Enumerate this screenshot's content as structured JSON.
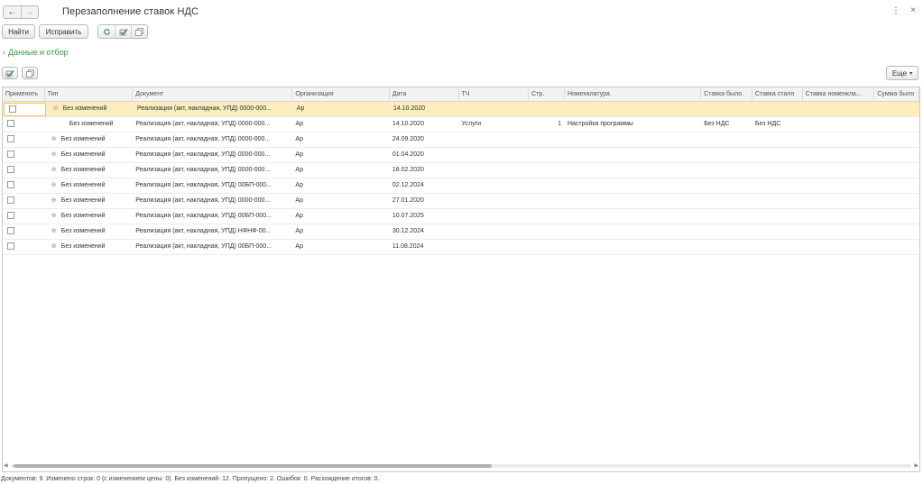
{
  "window": {
    "title": "Перезаполнение ставок НДС",
    "more_icon": "more-vertical-icon",
    "close_icon": "close-icon"
  },
  "toolbar": {
    "find_label": "Найти",
    "fix_label": "Исправить"
  },
  "filter": {
    "toggle_label": "Данные и отбор"
  },
  "grid_toolbar": {
    "more_label": "Еще"
  },
  "table": {
    "columns": {
      "apply": "Применять",
      "type": "Тип",
      "document": "Документ",
      "org": "Организация",
      "date": "Дата",
      "tch": "ТЧ",
      "str": "Стр.",
      "nom": "Номенклатура",
      "before": "Ставка было",
      "after": "Ставка стало",
      "nomrate": "Ставка номенкла...",
      "sum": "Сумма было"
    },
    "rows": [
      {
        "type": "Без изменений",
        "document": "Реализация (акт, накладная, УПД) 0000-000...",
        "org": "Ар",
        "date": "14.10.2020",
        "tch": "",
        "str": "",
        "nom": "",
        "before": "",
        "after": "",
        "nomrate": "",
        "sum": ""
      },
      {
        "type": "Без изменений",
        "document": "Реализация (акт, накладная, УПД) 0000-000...",
        "org": "Ар",
        "date": "14.10.2020",
        "tch": "Услуги",
        "str": "1",
        "nom": "Настройка программы",
        "before": "Без НДС",
        "after": "Без НДС",
        "nomrate": "",
        "sum": ""
      },
      {
        "type": "Без изменений",
        "document": "Реализация (акт, накладная, УПД) 0000-000...",
        "org": "Ар",
        "date": "24.09.2020",
        "tch": "",
        "str": "",
        "nom": "",
        "before": "",
        "after": "",
        "nomrate": "",
        "sum": ""
      },
      {
        "type": "Без изменений",
        "document": "Реализация (акт, накладная, УПД) 0000-000...",
        "org": "Ар",
        "date": "01.04.2020",
        "tch": "",
        "str": "",
        "nom": "",
        "before": "",
        "after": "",
        "nomrate": "",
        "sum": ""
      },
      {
        "type": "Без изменений",
        "document": "Реализация (акт, накладная, УПД) 0000-000...",
        "org": "Ар",
        "date": "18.02.2020",
        "tch": "",
        "str": "",
        "nom": "",
        "before": "",
        "after": "",
        "nomrate": "",
        "sum": ""
      },
      {
        "type": "Без изменений",
        "document": "Реализация (акт, накладная, УПД) 00БП-000...",
        "org": "Ар",
        "date": "02.12.2024",
        "tch": "",
        "str": "",
        "nom": "",
        "before": "",
        "after": "",
        "nomrate": "",
        "sum": ""
      },
      {
        "type": "Без изменений",
        "document": "Реализация (акт, накладная, УПД) 0000-000...",
        "org": "Ар",
        "date": "27.01.2020",
        "tch": "",
        "str": "",
        "nom": "",
        "before": "",
        "after": "",
        "nomrate": "",
        "sum": ""
      },
      {
        "type": "Без изменений",
        "document": "Реализация (акт, накладная, УПД) 00БП-000...",
        "org": "Ар",
        "date": "10.07.2025",
        "tch": "",
        "str": "",
        "nom": "",
        "before": "",
        "after": "",
        "nomrate": "",
        "sum": ""
      },
      {
        "type": "Без изменений",
        "document": "Реализация (акт, накладная, УПД) НФНФ-00...",
        "org": "Ар",
        "date": "30.12.2024",
        "tch": "",
        "str": "",
        "nom": "",
        "before": "",
        "after": "",
        "nomrate": "",
        "sum": ""
      },
      {
        "type": "Без изменений",
        "document": "Реализация (акт, накладная, УПД) 00БП-000...",
        "org": "Ар",
        "date": "11.08.2024",
        "tch": "",
        "str": "",
        "nom": "",
        "before": "",
        "after": "",
        "nomrate": "",
        "sum": ""
      }
    ]
  },
  "status": {
    "text": "Документов: 9. Изменено строк: 0 (с изменением цены: 0). Без изменений: 12. Пропущено: 2. Ошибок: 0. Расхождение итогов: 0."
  },
  "colors": {
    "accent_green": "#3a9a4b",
    "selected_row": "#fbedbc"
  }
}
